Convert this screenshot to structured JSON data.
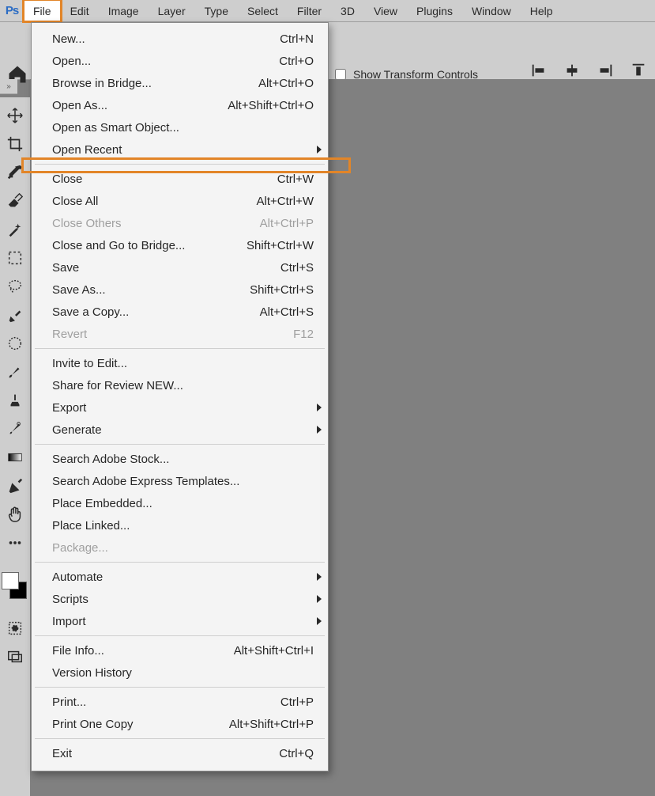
{
  "app_logo": "Ps",
  "menubar": [
    "File",
    "Edit",
    "Image",
    "Layer",
    "Type",
    "Select",
    "Filter",
    "3D",
    "View",
    "Plugins",
    "Window",
    "Help"
  ],
  "optionsbar": {
    "show_transform": "Show Transform Controls"
  },
  "mini_strip": "»",
  "tools": [
    "move-tool",
    "crop-tool",
    "eyedropper-tool",
    "eraser-tool",
    "magic-wand-tool",
    "marquee-tool",
    "lasso-tool",
    "brush-tool",
    "healing-brush-tool",
    "paint-brush-tool",
    "clone-stamp-tool",
    "history-brush-tool",
    "gradient-tool",
    "pen-tool",
    "hand-tool",
    "more-tools"
  ],
  "swatches": {
    "fg": "#ffffff",
    "bg": "#000000"
  },
  "extra_tools": [
    "quick-mask-tool",
    "screen-mode-tool"
  ],
  "file_menu": {
    "groups": [
      [
        {
          "label": "New...",
          "shortcut": "Ctrl+N"
        },
        {
          "label": "Open...",
          "shortcut": "Ctrl+O"
        },
        {
          "label": "Browse in Bridge...",
          "shortcut": "Alt+Ctrl+O"
        },
        {
          "label": "Open As...",
          "shortcut": "Alt+Shift+Ctrl+O"
        },
        {
          "label": "Open as Smart Object..."
        },
        {
          "label": "Open Recent",
          "submenu": true
        }
      ],
      [
        {
          "label": "Close",
          "shortcut": "Ctrl+W"
        },
        {
          "label": "Close All",
          "shortcut": "Alt+Ctrl+W"
        },
        {
          "label": "Close Others",
          "shortcut": "Alt+Ctrl+P",
          "disabled": true
        },
        {
          "label": "Close and Go to Bridge...",
          "shortcut": "Shift+Ctrl+W"
        },
        {
          "label": "Save",
          "shortcut": "Ctrl+S"
        },
        {
          "label": "Save As...",
          "shortcut": "Shift+Ctrl+S"
        },
        {
          "label": "Save a Copy...",
          "shortcut": "Alt+Ctrl+S"
        },
        {
          "label": "Revert",
          "shortcut": "F12",
          "disabled": true
        }
      ],
      [
        {
          "label": "Invite to Edit..."
        },
        {
          "label": "Share for Review NEW..."
        },
        {
          "label": "Export",
          "submenu": true
        },
        {
          "label": "Generate",
          "submenu": true
        }
      ],
      [
        {
          "label": "Search Adobe Stock..."
        },
        {
          "label": "Search Adobe Express Templates..."
        },
        {
          "label": "Place Embedded..."
        },
        {
          "label": "Place Linked..."
        },
        {
          "label": "Package...",
          "disabled": true
        }
      ],
      [
        {
          "label": "Automate",
          "submenu": true
        },
        {
          "label": "Scripts",
          "submenu": true
        },
        {
          "label": "Import",
          "submenu": true
        }
      ],
      [
        {
          "label": "File Info...",
          "shortcut": "Alt+Shift+Ctrl+I"
        },
        {
          "label": "Version History"
        }
      ],
      [
        {
          "label": "Print...",
          "shortcut": "Ctrl+P"
        },
        {
          "label": "Print One Copy",
          "shortcut": "Alt+Shift+Ctrl+P"
        }
      ],
      [
        {
          "label": "Exit",
          "shortcut": "Ctrl+Q"
        }
      ]
    ]
  }
}
